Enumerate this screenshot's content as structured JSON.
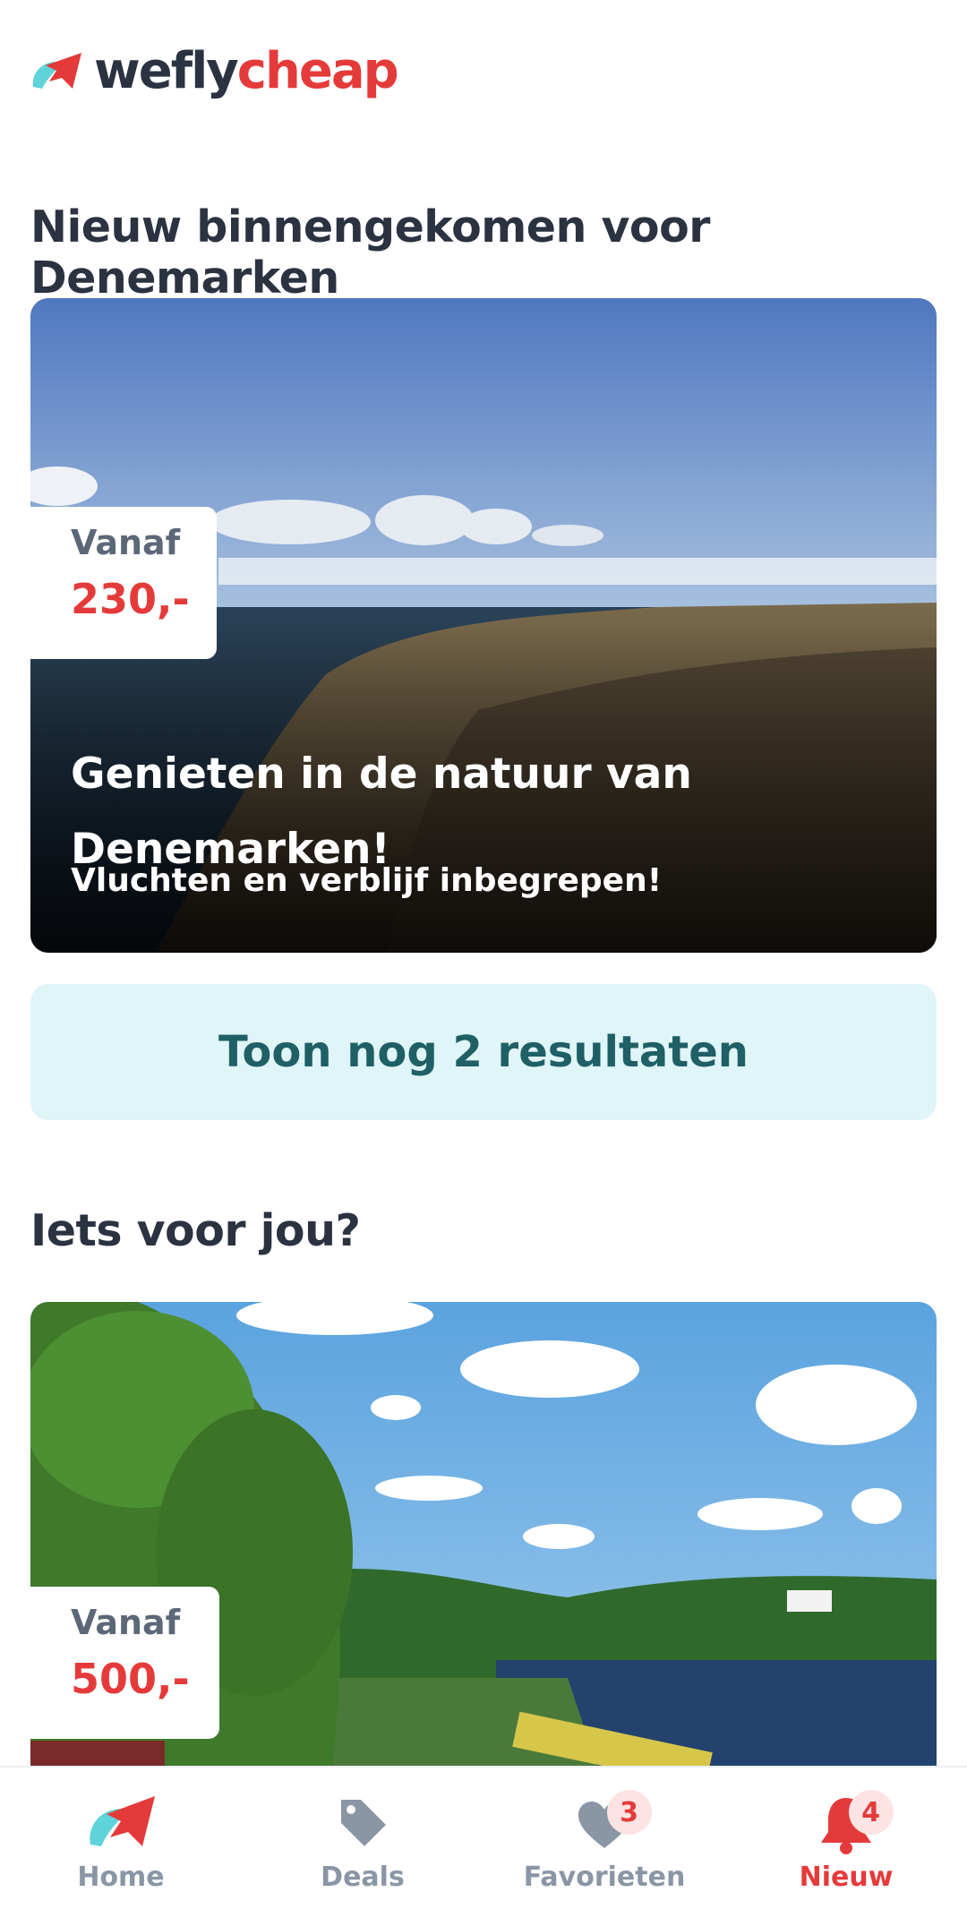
{
  "logo": {
    "part1": "wefly",
    "part2": "cheap"
  },
  "sections": {
    "new": "Nieuw binnengekomen voor Denemarken",
    "for_you": "Iets voor jou?"
  },
  "deal1": {
    "price_label": "Vanaf",
    "price": "230,-",
    "title": "Genieten in de natuur van Denemarken!",
    "subtitle": "Vluchten en verblijf inbegrepen!"
  },
  "more_button": "Toon nog 2 resultaten",
  "deal2": {
    "price_label": "Vanaf",
    "price": "500,-"
  },
  "tabs": [
    {
      "label": "Home",
      "icon": "plane-logo-icon"
    },
    {
      "label": "Deals",
      "icon": "tag-icon"
    },
    {
      "label": "Favorieten",
      "icon": "heart-icon",
      "badge": "3"
    },
    {
      "label": "Nieuw",
      "icon": "bell-icon",
      "badge": "4",
      "active": true
    }
  ],
  "colors": {
    "brand_red": "#e53a3a",
    "brand_dark": "#2b3240",
    "brand_teal": "#5ed3d9",
    "button_bg": "#dff5f7",
    "button_text": "#1f5f66"
  }
}
